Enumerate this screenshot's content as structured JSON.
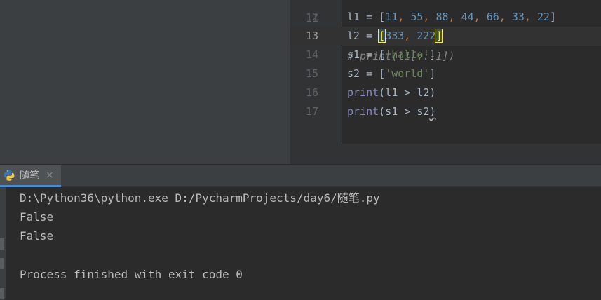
{
  "editor": {
    "top_partial": "# print(l1[::-1])",
    "lines": [
      {
        "num": "12",
        "segments": [
          {
            "t": "l1 = [",
            "c": "plain"
          },
          {
            "t": "11",
            "c": "num"
          },
          {
            "t": ", ",
            "c": "op"
          },
          {
            "t": "55",
            "c": "num"
          },
          {
            "t": ", ",
            "c": "op"
          },
          {
            "t": "88",
            "c": "num"
          },
          {
            "t": ", ",
            "c": "op"
          },
          {
            "t": "44",
            "c": "num"
          },
          {
            "t": ", ",
            "c": "op"
          },
          {
            "t": "66",
            "c": "num"
          },
          {
            "t": ", ",
            "c": "op"
          },
          {
            "t": "33",
            "c": "num"
          },
          {
            "t": ", ",
            "c": "op"
          },
          {
            "t": "22",
            "c": "num"
          },
          {
            "t": "]",
            "c": "plain"
          }
        ]
      },
      {
        "num": "13",
        "current": true,
        "segments": [
          {
            "t": "l2 = ",
            "c": "plain"
          },
          {
            "t": "[",
            "c": "bracket"
          },
          {
            "t": "333",
            "c": "num"
          },
          {
            "t": ", ",
            "c": "op"
          },
          {
            "t": "222",
            "c": "num"
          },
          {
            "t": "]",
            "c": "bracket"
          }
        ]
      },
      {
        "num": "14",
        "segments": [
          {
            "t": "s1 = [",
            "c": "plain"
          },
          {
            "t": "'hallo'",
            "c": "str"
          },
          {
            "t": "]",
            "c": "plain"
          }
        ]
      },
      {
        "num": "15",
        "segments": [
          {
            "t": "s2 = [",
            "c": "plain"
          },
          {
            "t": "'world'",
            "c": "str"
          },
          {
            "t": "]",
            "c": "plain"
          }
        ]
      },
      {
        "num": "16",
        "segments": [
          {
            "t": "print",
            "c": "fn"
          },
          {
            "t": "(l1 > l2)",
            "c": "plain"
          }
        ]
      },
      {
        "num": "17",
        "segments": [
          {
            "t": "print",
            "c": "fn"
          },
          {
            "t": "(s1 > s2",
            "c": "plain"
          },
          {
            "t": ")",
            "c": "squiggle"
          }
        ]
      }
    ]
  },
  "run": {
    "tab_label": "随笔",
    "tab_icon": "python-icon",
    "close_glyph": "×",
    "console": [
      "D:\\Python36\\python.exe D:/PycharmProjects/day6/随笔.py",
      "False",
      "False",
      "",
      "Process finished with exit code 0"
    ]
  },
  "colors": {
    "background": "#2b2b2b",
    "panel": "#3c3f41",
    "number": "#6897bb",
    "keyword": "#cc7832",
    "string": "#6a8759",
    "builtin": "#8888c6",
    "text": "#a9b7c6",
    "bracket_match": "#ffef28",
    "tab_underline": "#4a88c7"
  }
}
